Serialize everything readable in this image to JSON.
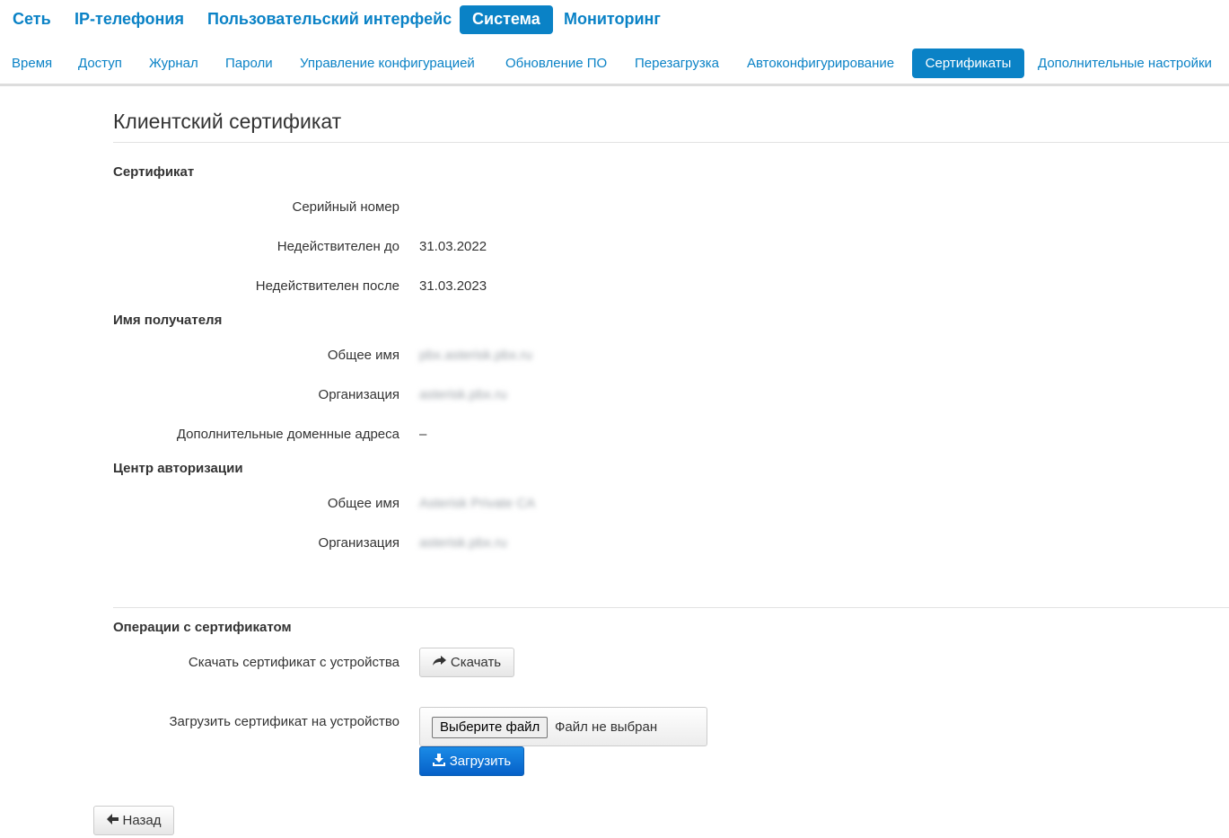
{
  "top_nav": [
    {
      "label": "Сеть"
    },
    {
      "label": "IP-телефония"
    },
    {
      "label": "Пользовательский интерфейс"
    },
    {
      "label": "Система"
    },
    {
      "label": "Мониторинг"
    }
  ],
  "top_nav_active": "Система",
  "sub_nav": [
    {
      "label": "Время"
    },
    {
      "label": "Доступ"
    },
    {
      "label": "Журнал"
    },
    {
      "label": "Пароли"
    },
    {
      "label": "Управление конфигурацией"
    },
    {
      "label": "Обновление ПО"
    },
    {
      "label": "Перезагрузка"
    },
    {
      "label": "Автоконфигурирование"
    },
    {
      "label": "Сертификаты"
    },
    {
      "label": "Дополнительные настройки"
    }
  ],
  "sub_nav_active": "Сертификаты",
  "page_title": "Клиентский сертификат",
  "certificate": {
    "heading": "Сертификат",
    "serial_label": "Серийный номер",
    "serial_value": "",
    "not_before_label": "Недействителен до",
    "not_before_value": "31.03.2022",
    "not_after_label": "Недействителен после",
    "not_after_value": "31.03.2023"
  },
  "subject": {
    "heading": "Имя получателя",
    "common_name_label": "Общее имя",
    "common_name_value": "pbx.asterisk.pbx.ru",
    "organization_label": "Организация",
    "organization_value": "asterisk.pbx.ru",
    "alt_names_label": "Дополнительные доменные адреса",
    "alt_names_value": "–"
  },
  "issuer": {
    "heading": "Центр авторизации",
    "common_name_label": "Общее имя",
    "common_name_value": "Asterisk Private CA",
    "organization_label": "Организация",
    "organization_value": "asterisk.pbx.ru"
  },
  "operations": {
    "heading": "Операции с сертификатом",
    "download_label": "Скачать сертификат с устройства",
    "download_button": "Скачать",
    "upload_label": "Загрузить сертификат на устройство",
    "file_button": "Выберите файл",
    "file_status": "Файл не выбран",
    "upload_button": "Загрузить"
  },
  "back_button": "Назад",
  "icons": {
    "download": "share-arrow-icon",
    "upload": "download-tray-icon",
    "back": "arrow-left-icon"
  },
  "colors": {
    "accent": "#0a82c6",
    "primary_button": "#0660c8"
  }
}
